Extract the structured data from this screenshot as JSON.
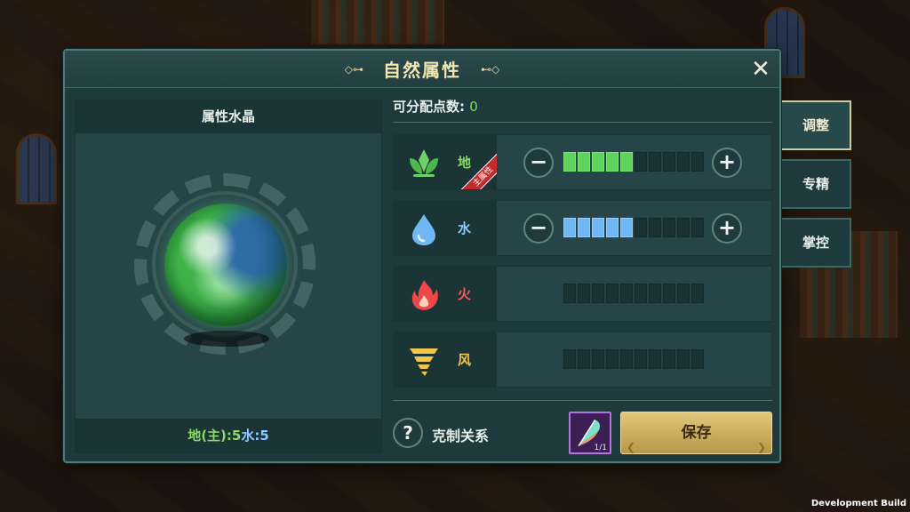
{
  "window": {
    "title": "自然属性",
    "close_label": "✕"
  },
  "crystal": {
    "header": "属性水晶",
    "footer_earth": "地(主):5",
    "footer_water": "水:5"
  },
  "points": {
    "label": "可分配点数:",
    "value": "0"
  },
  "elements": [
    {
      "name": "地",
      "icon": "leaf-icon",
      "color": "#8ad86a",
      "level": 5,
      "max": 10,
      "main": true,
      "main_label": "主属性",
      "minus": "−",
      "plus": "+"
    },
    {
      "name": "水",
      "icon": "water-drop-icon",
      "color": "#8cc8ff",
      "level": 5,
      "max": 10,
      "main": false,
      "minus": "−",
      "plus": "+"
    },
    {
      "name": "火",
      "icon": "fire-icon",
      "color": "#ff5a5a",
      "level": 0,
      "max": 10,
      "main": false
    },
    {
      "name": "风",
      "icon": "tornado-icon",
      "color": "#f0c64a",
      "level": 0,
      "max": 10,
      "main": false
    }
  ],
  "footer": {
    "help_label": "?",
    "relation_label": "克制关系",
    "item_count": "1/1",
    "save_label": "保存"
  },
  "tabs": [
    {
      "label": "调整",
      "active": true
    },
    {
      "label": "专精",
      "active": false
    },
    {
      "label": "掌控",
      "active": false
    }
  ],
  "dev_build": "Development Build"
}
